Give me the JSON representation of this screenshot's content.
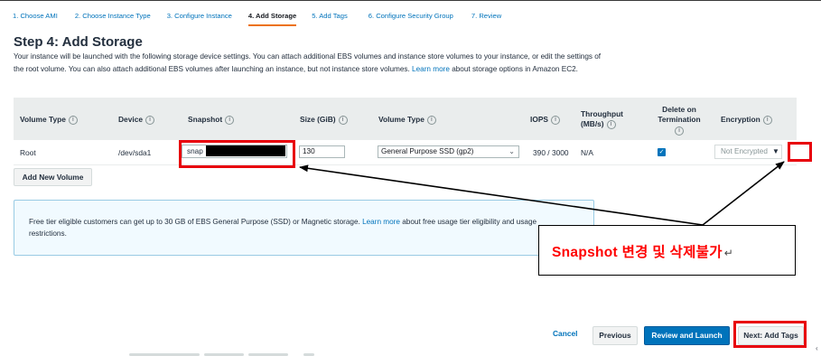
{
  "wizard": {
    "steps": [
      "1. Choose AMI",
      "2. Choose Instance Type",
      "3. Configure Instance",
      "4. Add Storage",
      "5. Add Tags",
      "6. Configure Security Group",
      "7. Review"
    ]
  },
  "page": {
    "title": "Step 4: Add Storage",
    "description_part1": "Your instance will be launched with the following storage device settings. You can attach additional EBS volumes and instance store volumes to your instance, or edit the settings of the root volume. You can also attach additional EBS volumes after launching an instance, but not instance store volumes.",
    "description_link": "Learn more",
    "description_part2": "about storage options in Amazon EC2."
  },
  "table": {
    "headers": {
      "volume_type": "Volume Type",
      "device": "Device",
      "snapshot": "Snapshot",
      "size": "Size (GiB)",
      "ebs_volume_type": "Volume Type",
      "iops": "IOPS",
      "throughput": "Throughput (MB/s)",
      "delete_on_termination": "Delete on Termination",
      "encryption": "Encryption"
    },
    "info_glyph": "i",
    "row": {
      "volume_type": "Root",
      "device": "/dev/sda1",
      "snapshot": "snap",
      "size": "130",
      "ebs_volume_type": "General Purpose SSD (gp2)",
      "iops": "390 / 3000",
      "throughput": "N/A",
      "delete_on_termination": true,
      "encryption": "Not Encrypted"
    }
  },
  "add_volume_button": "Add New Volume",
  "info_box": {
    "text_part1": "Free tier eligible customers can get up to 30 GB of EBS General Purpose (SSD) or Magnetic storage.",
    "link": "Learn more",
    "text_part2": "about free usage tier eligibility and usage restrictions."
  },
  "annotation": {
    "text": "Snapshot 변경 및 삭제불가",
    "return_mark": "↵"
  },
  "footer": {
    "cancel": "Cancel",
    "previous": "Previous",
    "review_and_launch": "Review and Launch",
    "next": "Next: Add Tags"
  },
  "colors": {
    "link": "#0073bb",
    "active_step_underline": "#ec7211",
    "primary_button": "#0073bb",
    "highlight_box": "#e8000b",
    "annotation_text": "#ff0000",
    "table_header_bg": "#eaeded",
    "info_box_bg": "#f1faff"
  },
  "icons": [
    "info-icon",
    "chevron-down-icon",
    "checkbox-checked-icon",
    "arrow-icon"
  ]
}
